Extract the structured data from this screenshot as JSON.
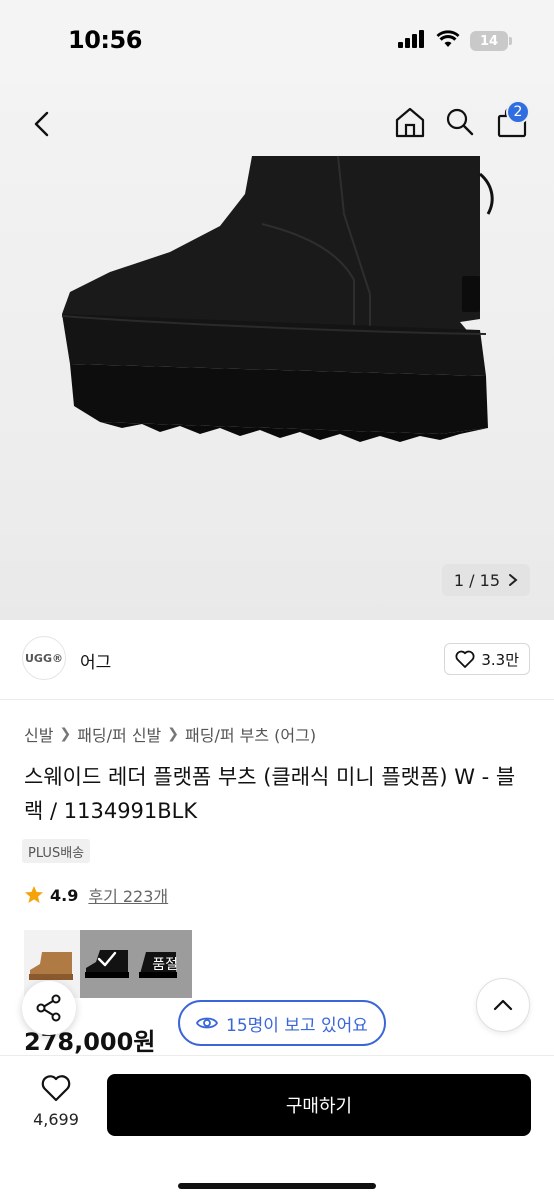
{
  "status": {
    "time": "10:56",
    "battery": "14"
  },
  "nav": {
    "cart_count": "2"
  },
  "gallery": {
    "pager": "1 / 15"
  },
  "brand": {
    "logo_text": "UGG®",
    "name": "어그",
    "likes": "3.3만"
  },
  "breadcrumb": [
    "신발",
    "패딩/퍼 신발",
    "패딩/퍼 부츠 (어그)"
  ],
  "product": {
    "title": "스웨이드 레더 플랫폼 부츠 (클래식 미니 플랫폼) W - 블랙 / 1134991BLK",
    "delivery_badge": "PLUS배송",
    "rating": "4.9",
    "review_link": "후기 223개",
    "price": "278,000원"
  },
  "options": {
    "soldout_label": "품절"
  },
  "floating": {
    "viewers": "15명이 보고 있어요"
  },
  "bottom": {
    "wish_count": "4,699",
    "buy_label": "구매하기"
  },
  "colors": {
    "accent": "#3a66d8",
    "badge": "#2f6de0",
    "buy_button": "#000000"
  }
}
